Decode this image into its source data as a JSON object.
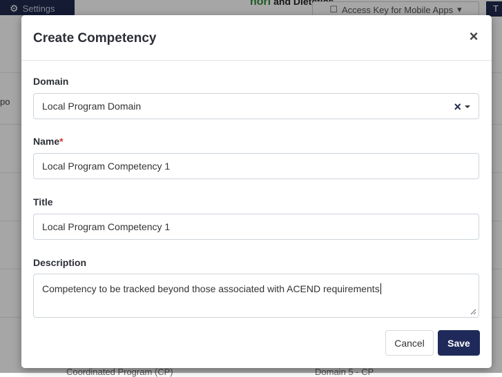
{
  "background": {
    "settings_label": "Settings",
    "header_text": "and Dietetics",
    "header_partial": "nori",
    "access_key_label": "Access Key for Mobile Apps",
    "right_partial": "T",
    "left_clip": "po",
    "bottom_left": "Coordinated Program (CP)",
    "bottom_right": "Domain 5 - CP"
  },
  "modal": {
    "title": "Create Competency",
    "close_symbol": "×",
    "domain": {
      "label": "Domain",
      "value": "Local Program Domain",
      "clear_symbol": "×"
    },
    "name": {
      "label": "Name",
      "required_mark": "*",
      "value": "Local Program Competency 1"
    },
    "title_field": {
      "label": "Title",
      "value": "Local Program Competency 1"
    },
    "description": {
      "label": "Description",
      "value": "Competency to be tracked beyond those associated with ACEND requirements"
    },
    "buttons": {
      "cancel": "Cancel",
      "save": "Save"
    }
  }
}
